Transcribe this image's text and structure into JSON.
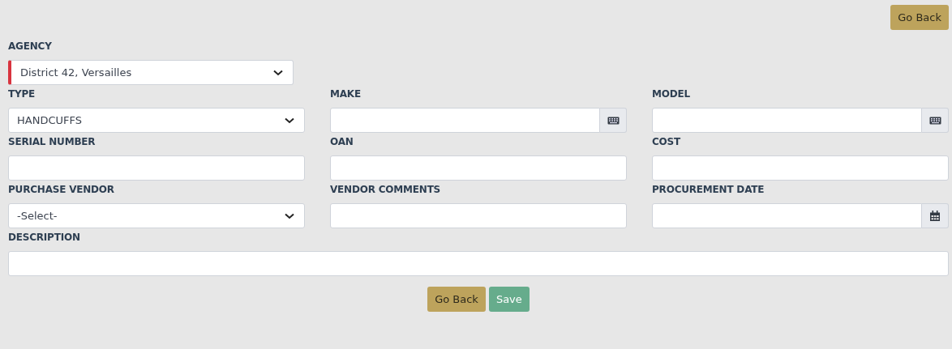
{
  "top_button": {
    "label": "Go Back"
  },
  "agency": {
    "label": "AGENCY",
    "kind": "select",
    "value": "District 42, Versailles",
    "required": true
  },
  "fields": [
    {
      "label": "TYPE",
      "kind": "select",
      "value": "HANDCUFFS",
      "required": false
    },
    {
      "label": "MAKE",
      "kind": "keyboard",
      "required": false
    },
    {
      "label": "MODEL",
      "kind": "keyboard",
      "required": false
    },
    {
      "label": "SERIAL NUMBER",
      "kind": "text",
      "required": false
    },
    {
      "label": "OAN",
      "kind": "text",
      "required": false
    },
    {
      "label": "COST",
      "kind": "text",
      "required": false
    },
    {
      "label": "PURCHASE VENDOR",
      "kind": "select",
      "value": "-Select-",
      "required": false
    },
    {
      "label": "VENDOR COMMENTS",
      "kind": "text",
      "required": false
    },
    {
      "label": "PROCUREMENT DATE",
      "kind": "date",
      "required": false
    },
    {
      "label": "DESCRIPTION",
      "kind": "text",
      "required": false,
      "wide": true
    }
  ],
  "buttons": [
    {
      "label": "Go Back",
      "kind": "back"
    },
    {
      "label": "Save",
      "kind": "save"
    }
  ]
}
